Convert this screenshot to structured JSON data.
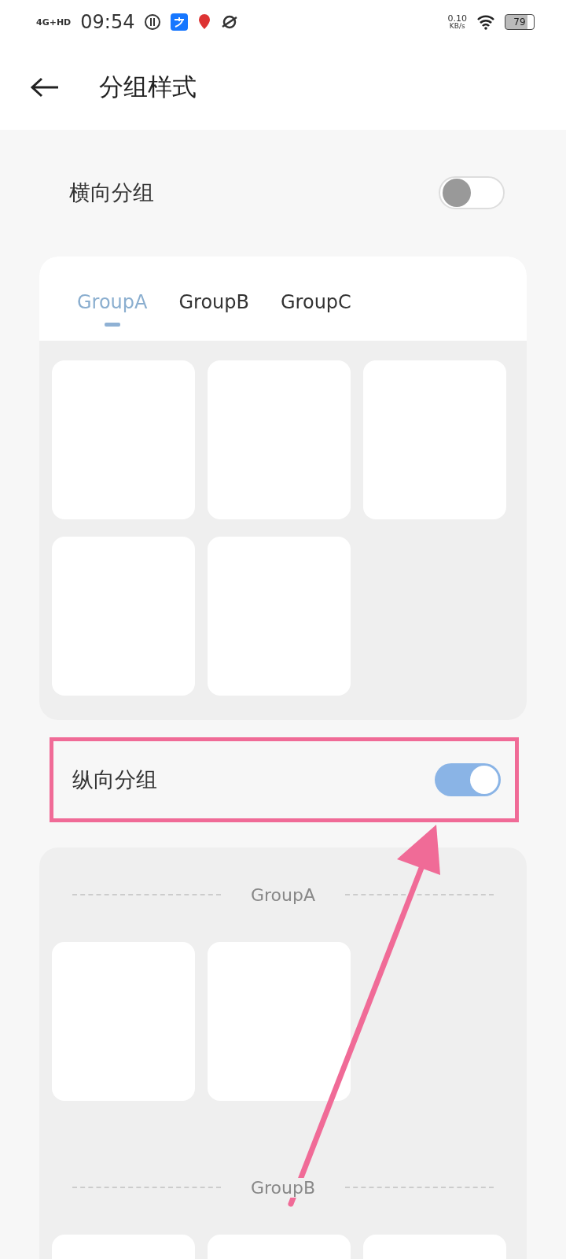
{
  "status_bar": {
    "network": "4G+HD",
    "time": "09:54",
    "speed": "0.10",
    "speed_unit": "KB/s",
    "battery": "79"
  },
  "header": {
    "title": "分组样式"
  },
  "settings": [
    {
      "label": "横向分组",
      "on": false,
      "highlighted": false,
      "preview": {
        "kind": "tabs",
        "tabs": [
          {
            "label": "GroupA",
            "selected": true
          },
          {
            "label": "GroupB",
            "selected": false
          },
          {
            "label": "GroupC",
            "selected": false
          }
        ],
        "tiles": [
          {
            "kind": "blank"
          },
          {
            "kind": "blank"
          },
          {
            "kind": "blank"
          },
          {
            "kind": "blank"
          },
          {
            "kind": "blank"
          }
        ]
      }
    },
    {
      "label": "纵向分组",
      "on": true,
      "highlighted": true,
      "preview": {
        "kind": "sections",
        "sections": [
          {
            "title": "GroupA",
            "tiles": [
              {
                "kind": "blank"
              },
              {
                "kind": "blank"
              }
            ]
          },
          {
            "title": "GroupB",
            "tiles": [
              {
                "kind": "blank"
              },
              {
                "kind": "blank"
              },
              {
                "kind": "blank"
              }
            ]
          }
        ]
      }
    }
  ],
  "annotation": {
    "arrow": true
  }
}
